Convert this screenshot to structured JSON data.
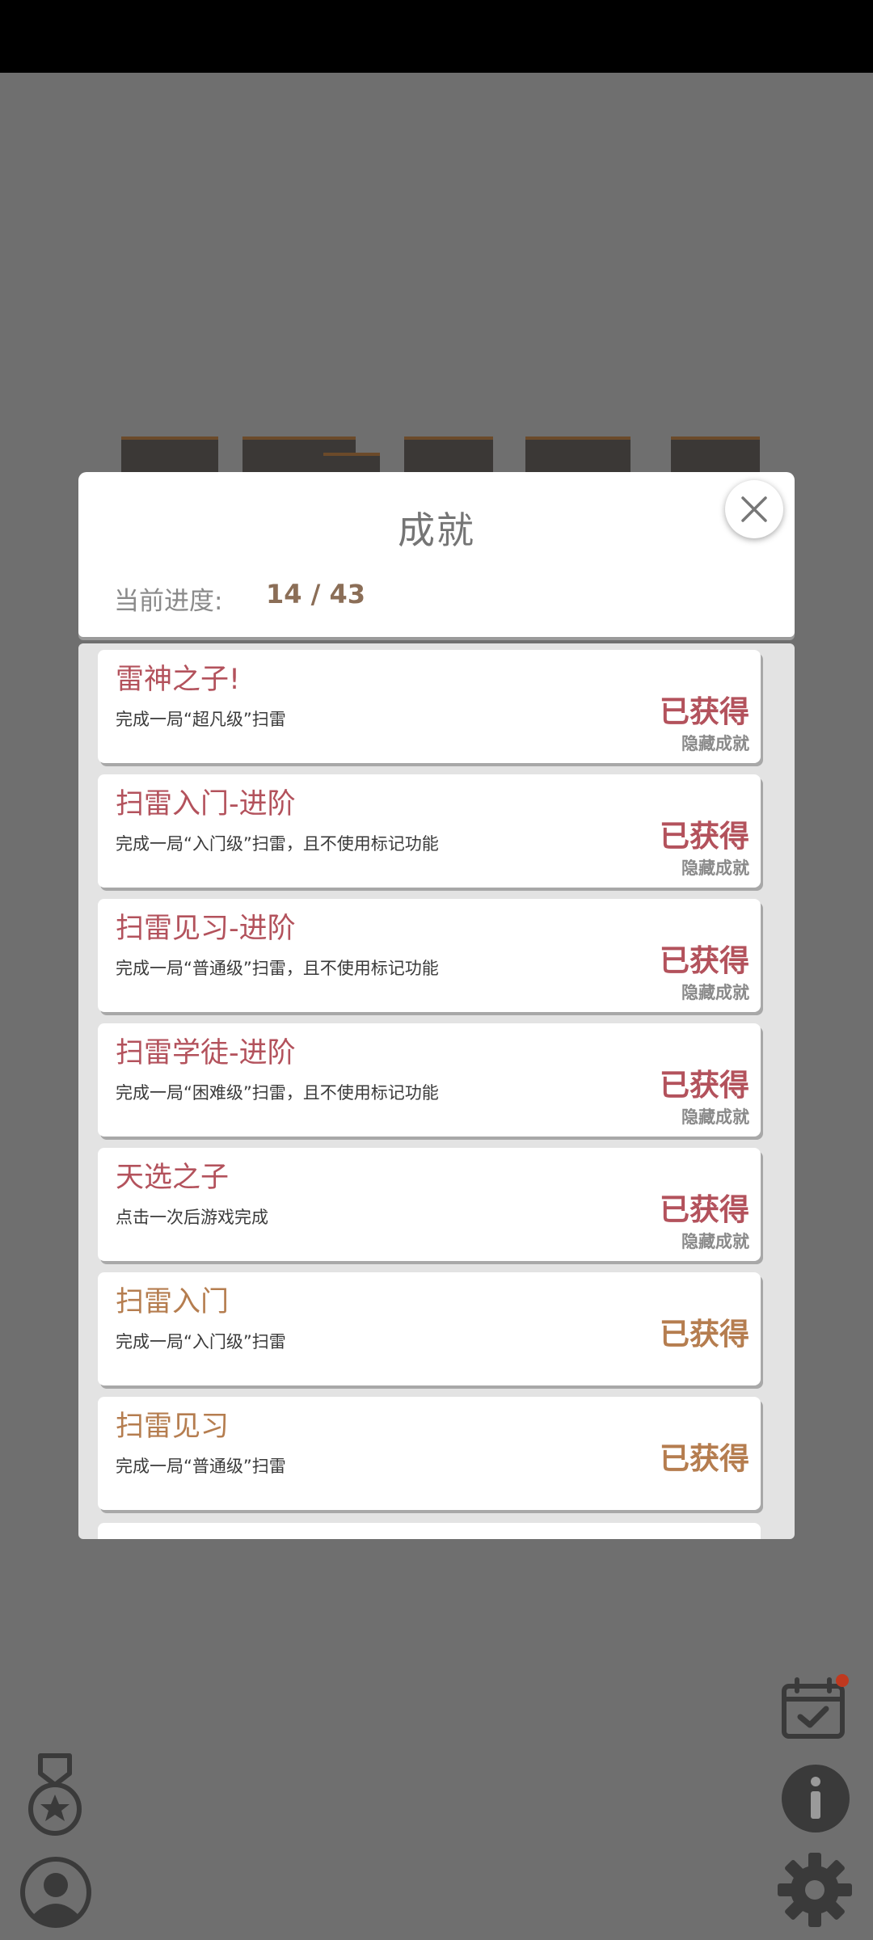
{
  "modal": {
    "title": "成就",
    "progress_label": "当前进度:",
    "progress_value": "14 / 43"
  },
  "colors": {
    "hidden_accent": "#b3525c",
    "normal_accent": "#b57d4f",
    "overlay": "#6f6f6f"
  },
  "achievements": [
    {
      "title": "雷神之子!",
      "desc": "完成一局“超凡级”扫雷",
      "status": "已获得",
      "tag": "隐藏成就",
      "hidden": true
    },
    {
      "title": "扫雷入门-进阶",
      "desc": "完成一局“入门级”扫雷，且不使用标记功能",
      "status": "已获得",
      "tag": "隐藏成就",
      "hidden": true
    },
    {
      "title": "扫雷见习-进阶",
      "desc": "完成一局“普通级”扫雷，且不使用标记功能",
      "status": "已获得",
      "tag": "隐藏成就",
      "hidden": true
    },
    {
      "title": "扫雷学徒-进阶",
      "desc": "完成一局“困难级”扫雷，且不使用标记功能",
      "status": "已获得",
      "tag": "隐藏成就",
      "hidden": true
    },
    {
      "title": "天选之子",
      "desc": "点击一次后游戏完成",
      "status": "已获得",
      "tag": "隐藏成就",
      "hidden": true
    },
    {
      "title": "扫雷入门",
      "desc": "完成一局“入门级”扫雷",
      "status": "已获得",
      "tag": "",
      "hidden": false
    },
    {
      "title": "扫雷见习",
      "desc": "完成一局“普通级”扫雷",
      "status": "已获得",
      "tag": "",
      "hidden": false
    }
  ],
  "icons": {
    "close": "close-icon",
    "calendar": "calendar-check-icon",
    "info": "info-icon",
    "settings": "gear-icon",
    "medal": "medal-icon",
    "profile": "profile-icon"
  }
}
